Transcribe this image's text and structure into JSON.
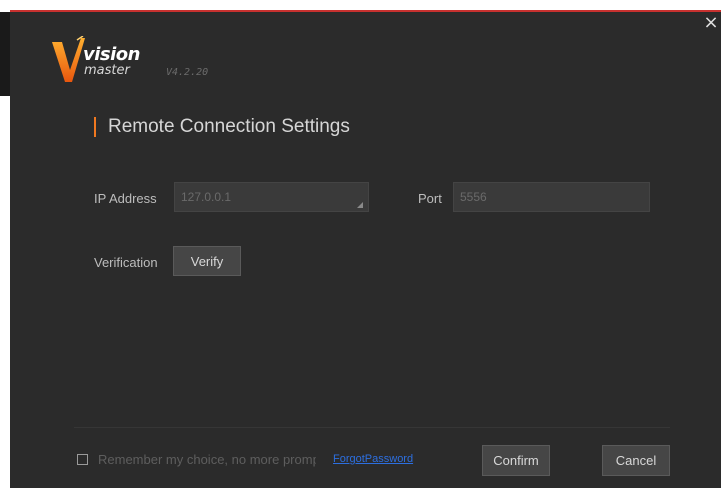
{
  "window": {
    "close_label": "×"
  },
  "logo": {
    "word1": "vision",
    "word2": "master",
    "version": "V4.2.20"
  },
  "title": "Remote Connection Settings",
  "ip": {
    "label": "IP Address",
    "value": "127.0.0.1"
  },
  "port": {
    "label": "Port",
    "value": "5556"
  },
  "verification": {
    "label": "Verification",
    "button": "Verify"
  },
  "footer": {
    "remember": "Remember my choice, no more prompt",
    "forgot": "ForgotPassword",
    "confirm": "Confirm",
    "cancel": "Cancel"
  },
  "colors": {
    "accent": "#f07820",
    "top_border": "#c8312f",
    "background": "#2b2b2b",
    "link": "#2d6fe0"
  }
}
